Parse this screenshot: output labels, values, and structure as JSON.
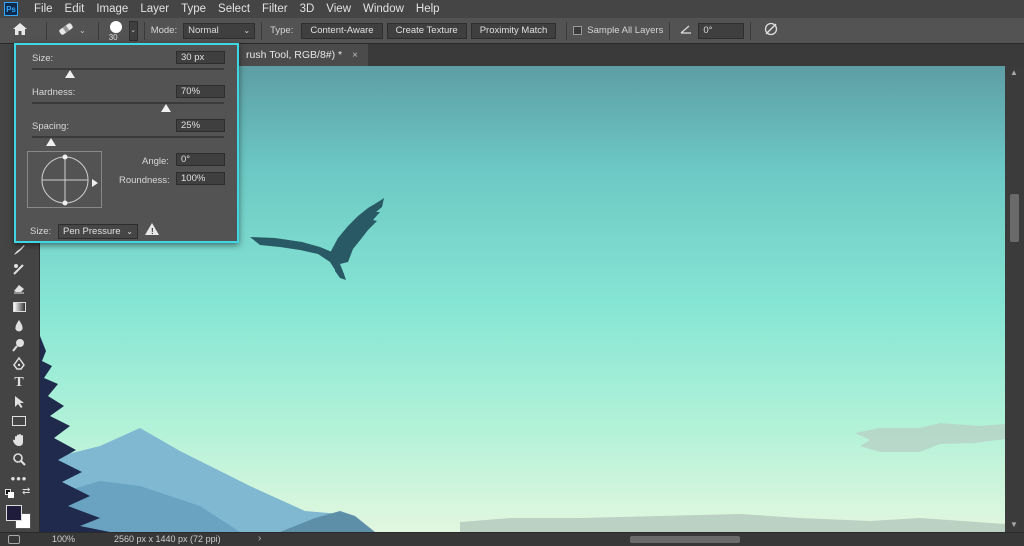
{
  "menu": [
    "File",
    "Edit",
    "Image",
    "Layer",
    "Type",
    "Select",
    "Filter",
    "3D",
    "View",
    "Window",
    "Help"
  ],
  "app_logo": "Ps",
  "options": {
    "brush_size": "30",
    "mode_label": "Mode:",
    "mode_value": "Normal",
    "type_label": "Type:",
    "type_buttons": [
      "Content-Aware",
      "Create Texture",
      "Proximity Match"
    ],
    "sample_all_layers": "Sample All Layers",
    "angle_value": "0°"
  },
  "document_tab": {
    "title": "rush Tool, RGB/8#) *",
    "close": "×"
  },
  "brush_popup": {
    "size_label": "Size:",
    "size_value": "30 px",
    "size_level": 0.2,
    "hardness_label": "Hardness:",
    "hardness_value": "70%",
    "hardness_level": 0.7,
    "spacing_label": "Spacing:",
    "spacing_value": "25%",
    "spacing_level": 0.1,
    "angle_label": "Angle:",
    "angle_value": "0°",
    "roundness_label": "Roundness:",
    "roundness_value": "100%",
    "size_control_label": "Size:",
    "size_control_value": "Pen Pressure"
  },
  "status": {
    "zoom": "100%",
    "info": "2560 px x 1440 px (72 ppi)",
    "arrow": "›"
  },
  "colors": {
    "popup_border": "#3fd7e3",
    "foreground": "#1f1b3a",
    "background": "#ffffff"
  },
  "icons": {
    "home": "home-icon",
    "healing_brush": "healing-brush-icon",
    "angle": "angle-icon",
    "pressure": "pressure-icon",
    "warning": "warning-icon"
  }
}
